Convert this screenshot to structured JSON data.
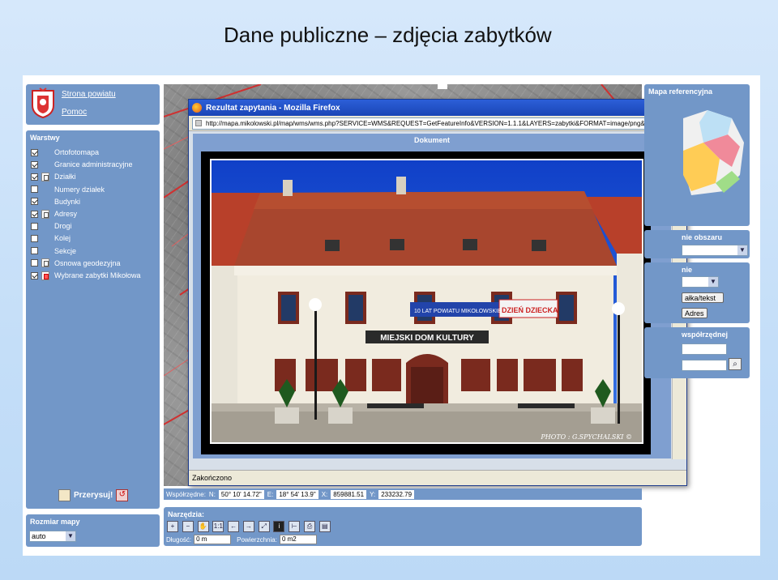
{
  "slide": {
    "title": "Dane publiczne – zdjęcia zabytków"
  },
  "links": {
    "strona_powiatu": "Strona powiatu",
    "pomoc": "Pomoc"
  },
  "layers": {
    "title": "Warstwy",
    "items": [
      {
        "label": "Ortofotomapa",
        "checked": true,
        "legend": false
      },
      {
        "label": "Granice administracyjne",
        "checked": true,
        "legend": false
      },
      {
        "label": "Działki",
        "checked": true,
        "legend": true
      },
      {
        "label": "Numery działek",
        "checked": false,
        "legend": false
      },
      {
        "label": "Budynki",
        "checked": true,
        "legend": false
      },
      {
        "label": "Adresy",
        "checked": true,
        "legend": true
      },
      {
        "label": "Drogi",
        "checked": false,
        "legend": false
      },
      {
        "label": "Kolej",
        "checked": false,
        "legend": false
      },
      {
        "label": "Sekcje",
        "checked": false,
        "legend": false
      },
      {
        "label": "Osnowa geodezyjna",
        "checked": false,
        "legend": true
      },
      {
        "label": "Wybrane zabytki Mikołowa",
        "checked": true,
        "legend": true
      }
    ],
    "redraw_label": "Przerysuj!"
  },
  "map_size": {
    "title": "Rozmiar mapy",
    "selected": "auto"
  },
  "popup": {
    "window_title": "Rezultat zapytania - Mozilla Firefox",
    "url": "http://mapa.mikolowski.pl/map/wms/wms.php?SERVICE=WMS&REQUEST=GetFeatureInfo&VERSION=1.1.1&LAYERS=zabytki&FORMAT=image/png&TRANSPARENT=TRU",
    "doc_title": "Dokument",
    "photo_credit": "PHOTO : G.SPYCHALSKI ©",
    "building_sign": "MIEJSKI DOM KULTURY",
    "banner_1": "10 LAT POWIATU MIKOŁOWSKIEGO",
    "banner_2": "DZIEŃ DZIECKA",
    "status": "Zakończono"
  },
  "coords": {
    "label": "Współrzędne:",
    "n_label": "N:",
    "n_value": "50° 10' 14.72\"",
    "e_label": "E:",
    "e_value": "18° 54' 13.9\"",
    "x_label": "X:",
    "x_value": "859881.51",
    "y_label": "Y:",
    "y_value": "233232.79"
  },
  "tools": {
    "title": "Narzędzia:",
    "scale_label": "1:1",
    "length_label": "Długość:",
    "length_value": "0 m",
    "area_label": "Powierzchnia:",
    "area_value": "0 m2"
  },
  "right": {
    "ref_map_title": "Mapa referencyjna",
    "area_title": "nie obszaru",
    "search_title": "nie",
    "parcel_button": "ałka/tekst",
    "address_button": "Adres",
    "coords_title": "współrzędnej"
  },
  "colors": {
    "panel": "#7297c8",
    "titlebar": "#1a45b6",
    "roof": "#b8402a",
    "sky": "#1b55d6"
  }
}
